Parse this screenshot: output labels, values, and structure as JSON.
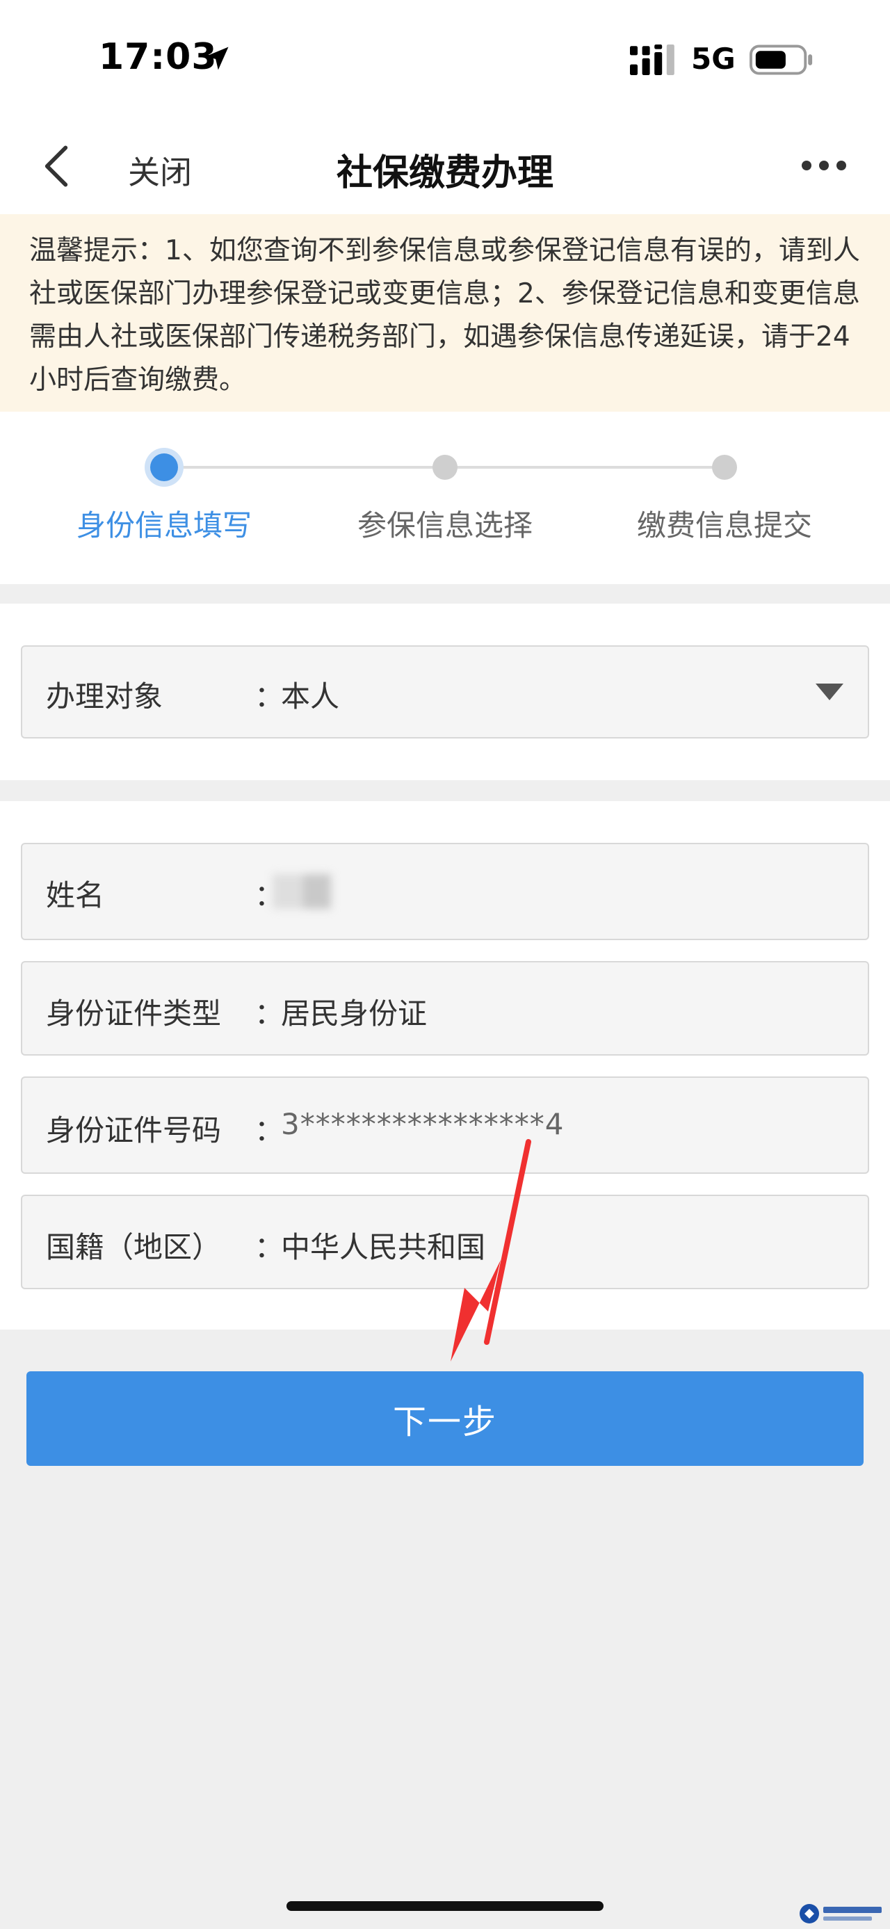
{
  "status_bar": {
    "time": "17:03",
    "network": "5G",
    "icons": [
      "location-arrow-icon",
      "signal-bars-icon",
      "battery-icon"
    ]
  },
  "nav": {
    "back_icon": "chevron-left-icon",
    "close_label": "关闭",
    "title": "社保缴费办理",
    "more_icon": "more-dots-icon"
  },
  "notice": {
    "text": "温馨提示：1、如您查询不到参保信息或参保登记信息有误的，请到人社或医保部门办理参保登记或变更信息；2、参保登记信息和变更信息需由人社或医保部门传递税务部门，如遇参保信息传递延误，请于24小时后查询缴费。"
  },
  "steps": [
    {
      "label": "身份信息填写",
      "state": "active"
    },
    {
      "label": "参保信息选择",
      "state": "pending"
    },
    {
      "label": "缴费信息提交",
      "state": "pending"
    }
  ],
  "applicant": {
    "label": "办理对象",
    "colon": "：",
    "value": "本人",
    "dropdown_icon": "caret-down-icon"
  },
  "fields": {
    "name": {
      "label": "姓名",
      "colon": "：",
      "value": ""
    },
    "id_type": {
      "label": "身份证件类型",
      "colon": "：",
      "value": "居民身份证"
    },
    "id_number": {
      "label": "身份证件号码",
      "colon": "：",
      "value": "3****************4"
    },
    "nationality": {
      "label": "国籍（地区）",
      "colon": "：",
      "value": "中华人民共和国"
    }
  },
  "next_button_label": "下一步",
  "colors": {
    "accent": "#3d8fe4",
    "notice_bg": "#fdf5e6",
    "page_bg": "#efefef",
    "annotation_arrow": "#f03030"
  }
}
